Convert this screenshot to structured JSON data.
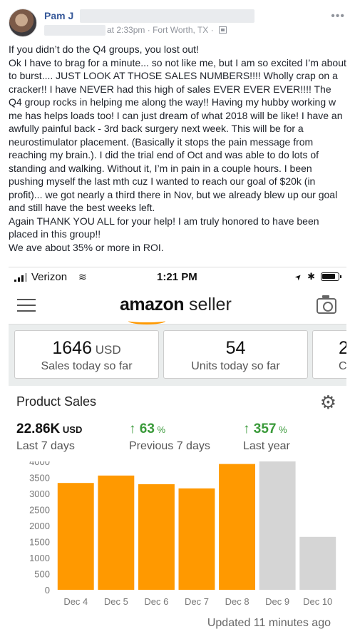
{
  "post": {
    "author": "Pam J",
    "time": "at 2:33pm",
    "separator": "·",
    "location": "Fort Worth, TX",
    "separator2": "·",
    "more": "•••",
    "paragraphs": [
      "If you didn’t do the Q4 groups, you lost out!",
      "Ok I have to brag for a minute... so not like me, but I am so excited I’m about to burst.... JUST LOOK AT THOSE SALES NUMBERS!!!! Wholly crap on a cracker!! I have NEVER had this high of sales EVER EVER EVER!!!! The Q4 group rocks in helping me along the way!! Having my hubby working w me has helps loads too! I can just dream of what 2018 will be like! I have an awfully painful back - 3rd back surgery next week. This will be for a neurostimulator placement. (Basically it stops the pain message from reaching my brain.). I did the trial end of Oct and was able to do lots of standing and walking. Without it, I’m in pain in a couple hours. I been pushing myself the last mth cuz I wanted to reach our goal of $20k (in profit)... we got nearly a third there in Nov, but we already blew up our goal and still have the best weeks left.",
      "Again THANK YOU ALL for your help! I am truly honored to have been placed in this group!!",
      "We ave about 35% or more in ROI."
    ]
  },
  "phone": {
    "carrier": "Verizon",
    "wifi": "≋",
    "time": "1:21 PM",
    "location_arrow": "➤",
    "bluetooth": "✱"
  },
  "app": {
    "logo_amazon": "amazon",
    "logo_seller": " seller",
    "cards": [
      {
        "value": "1646",
        "unit": " USD",
        "label": "Sales today so far"
      },
      {
        "value": "54",
        "unit": "",
        "label": "Units today so far"
      },
      {
        "value": "2",
        "unit": "",
        "label": "C"
      }
    ],
    "panel_title": "Product Sales",
    "gear": "⚙",
    "metrics": {
      "total": {
        "value": "22.86K",
        "unit": " USD",
        "label": "Last 7 days"
      },
      "prev": {
        "arrow": "↑",
        "value": " 63",
        "pct": " %",
        "label": "Previous 7 days"
      },
      "year": {
        "arrow": "↑",
        "value": " 357",
        "pct": " %",
        "label": "Last year"
      }
    },
    "updated": "Updated 11 minutes ago"
  },
  "chart_data": {
    "type": "bar",
    "categories": [
      "Dec 4",
      "Dec 5",
      "Dec 6",
      "Dec 7",
      "Dec 8",
      "Dec 9",
      "Dec 10"
    ],
    "values": [
      3330,
      3560,
      3290,
      3160,
      3920,
      4000,
      1650
    ],
    "colors": [
      "#ff9900",
      "#ff9900",
      "#ff9900",
      "#ff9900",
      "#ff9900",
      "#d5d5d5",
      "#d5d5d5"
    ],
    "yticks": [
      "0",
      "500",
      "1000",
      "1500",
      "2000",
      "2500",
      "3000",
      "3500",
      "4000"
    ],
    "ylim": [
      0,
      4000
    ],
    "title": "",
    "xlabel": "",
    "ylabel": ""
  }
}
